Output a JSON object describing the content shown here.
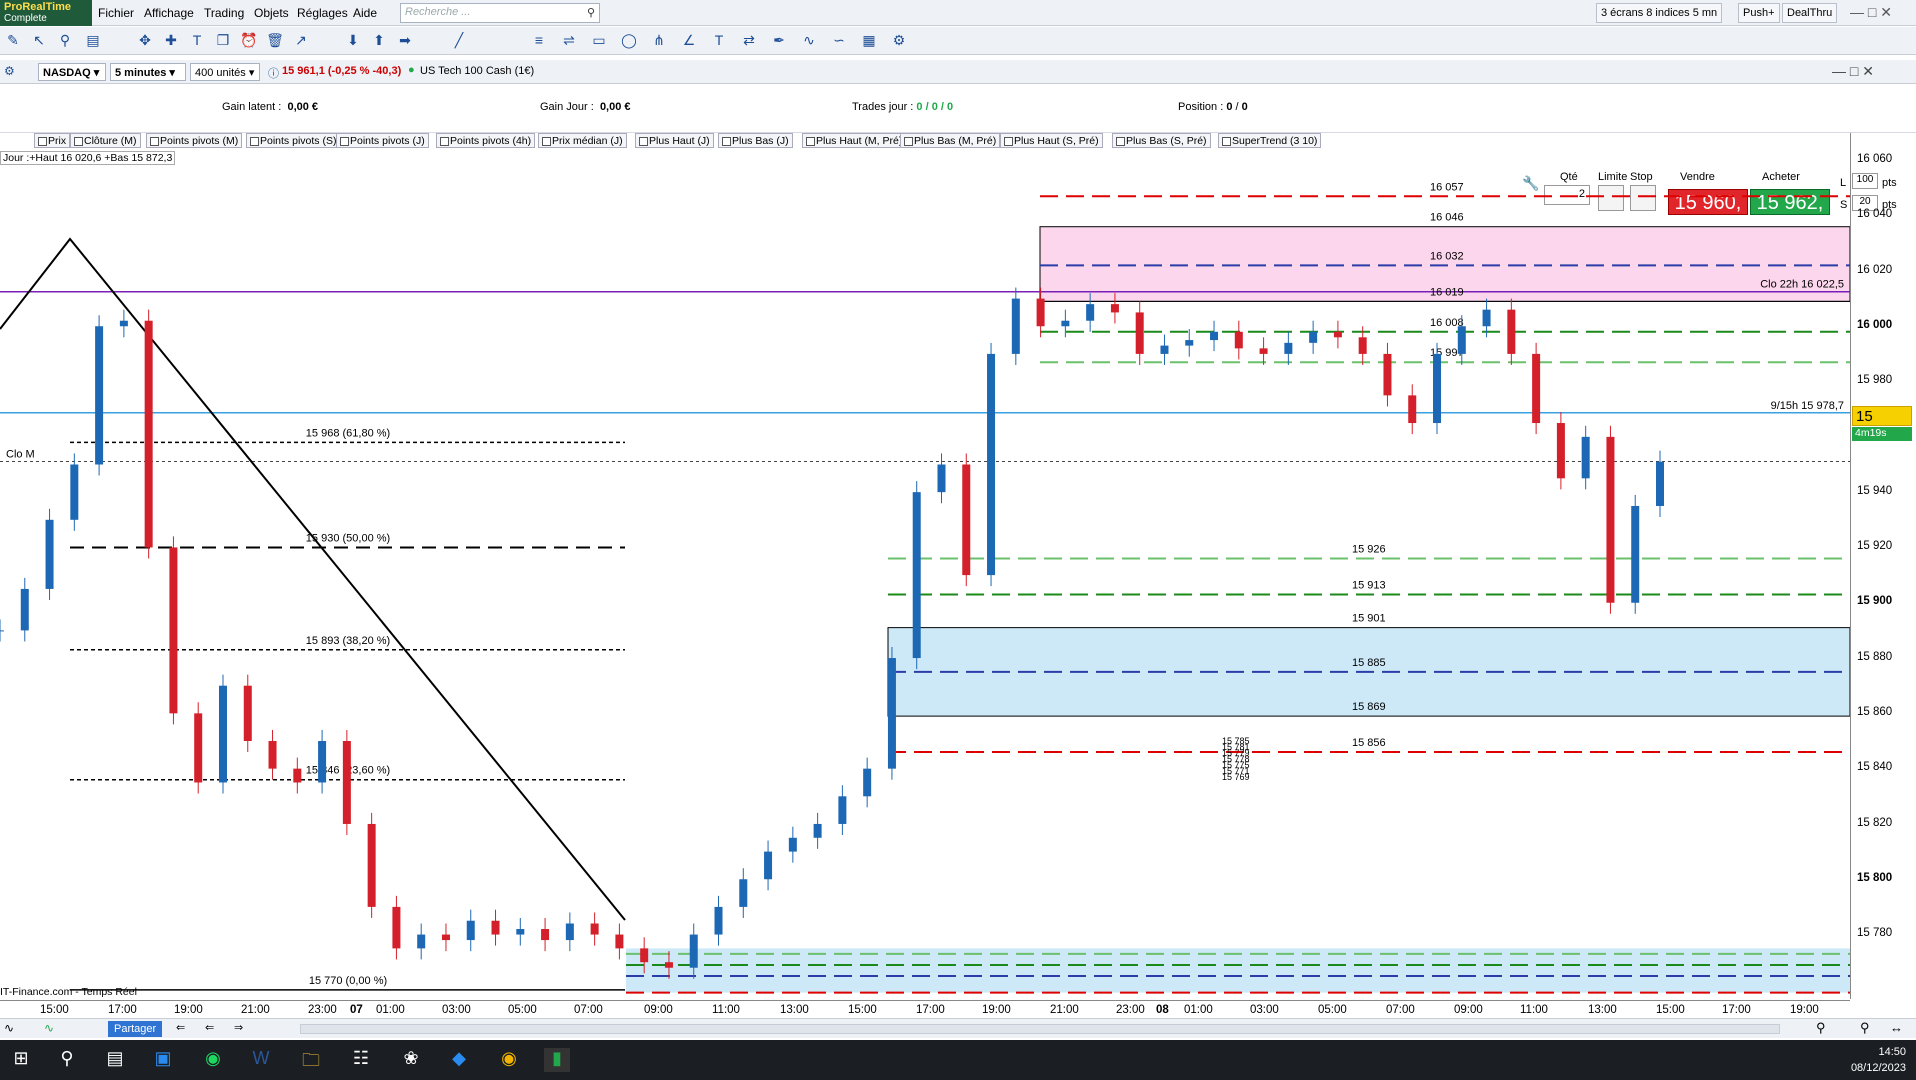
{
  "app": {
    "logo_line1": "ProRealTime",
    "logo_line2": "Complete"
  },
  "menu": [
    "Fichier",
    "Affichage",
    "Trading",
    "Objets",
    "Réglages",
    "Aide"
  ],
  "search": {
    "placeholder": "Recherche ..."
  },
  "topright": {
    "layout": "3 écrans 8 indices 5 mn",
    "push": "Push+",
    "dealthru": "DealThru"
  },
  "instrument": {
    "market": "NASDAQ",
    "timeframe": "5 minutes",
    "units": "400 unités",
    "quote": "15 961,1 (-0,25 % -40,3)",
    "name": "US Tech 100 Cash (1€)"
  },
  "info": {
    "gain_latent_label": "Gain latent :",
    "gain_latent": "0,00 €",
    "gain_jour_label": "Gain Jour :",
    "gain_jour": "0,00 €",
    "trades_label": "Trades jour :",
    "trades": "0 / 0 / 0",
    "position_label": "Position :",
    "position": "0",
    "position2": "0"
  },
  "order": {
    "qte_label": "Qté",
    "qte": "2",
    "limite_label": "Limite",
    "stop_label": "Stop",
    "vendre_label": "Vendre",
    "acheter_label": "Acheter",
    "sell": "15 960,",
    "buy": "15 962,",
    "l_label": "L",
    "l_val": "100",
    "s_label": "S",
    "s_val": "20",
    "pts": "pts"
  },
  "indicators": [
    "Prix",
    "Clôture (M)",
    "Points pivots (M)",
    "Points pivots (S)",
    "Points pivots (J)",
    "Points pivots (4h)",
    "Prix médian (J)",
    "Plus Haut (J)",
    "Plus Bas (J)",
    "Plus Haut (M, Pré)",
    "Plus Bas (M, Pré)",
    "Plus Haut (S, Pré)",
    "Plus Bas (S, Pré)",
    "SuperTrend (3 10)"
  ],
  "jour_label": "Jour :+Haut 16 020,6 +Bas 15 872,3",
  "source": "IT-Finance.com - Temps Réel",
  "y_ticks": [
    "16 060",
    "16 040",
    "16 020",
    "16 000",
    "15 980",
    "15 960",
    "15 940",
    "15 920",
    "15 900",
    "15 880",
    "15 860",
    "15 840",
    "15 820",
    "15 800",
    "15 780"
  ],
  "x_ticks": [
    "15:00",
    "17:00",
    "19:00",
    "21:00",
    "23:00",
    "07",
    "01:00",
    "03:00",
    "05:00",
    "07:00",
    "09:00",
    "11:00",
    "13:00",
    "15:00",
    "17:00",
    "19:00",
    "21:00",
    "23:00",
    "08",
    "01:00",
    "03:00",
    "05:00",
    "07:00",
    "09:00",
    "11:00",
    "13:00",
    "15:00",
    "17:00",
    "19:00"
  ],
  "fib_labels": [
    "15 968 (61,80 %)",
    "15 930 (50,00 %)",
    "15 893 (38,20 %)",
    "15 846 (23,60 %)",
    "15 770 (0,00 %)"
  ],
  "level_labels_top": [
    "16 057",
    "16 046",
    "16 032",
    "16 019",
    "16 008",
    "15 997"
  ],
  "level_labels_mid": [
    "15 926",
    "15 913",
    "15 901",
    "15 885",
    "15 869",
    "15 856"
  ],
  "level_labels_low": [
    "15 785",
    "15 781",
    "15 779",
    "15 778",
    "15 775",
    "15 771",
    "15 769"
  ],
  "annotations": {
    "clo22h": "Clo 22h 16 022,5",
    "nine15": "9/15h 15 978,7",
    "clom": "Clo M"
  },
  "price_badge": "15 961,1",
  "time_badge": "4m19s",
  "bottom": {
    "partager": "Partager"
  },
  "clock": {
    "time": "14:50",
    "date": "08/12/2023"
  },
  "chart_data": {
    "type": "line",
    "title": "",
    "ylim": [
      15760,
      16066
    ],
    "series": [
      {
        "values": [
          15900,
          15915,
          15940,
          15960,
          16010,
          16012,
          15930,
          15870,
          15845,
          15880,
          15860,
          15850,
          15845,
          15860,
          15830,
          15800,
          15785,
          15790,
          15788,
          15795,
          15790,
          15792,
          15788,
          15794,
          15790,
          15785,
          15780,
          15778,
          15790,
          15800,
          15810,
          15820,
          15825,
          15830,
          15840,
          15850,
          15890,
          15950,
          15960,
          15920,
          16000,
          16020,
          16010,
          16012,
          16018,
          16015,
          16000,
          16003,
          16005,
          16008,
          16002,
          16000,
          16004,
          16008,
          16006,
          16000,
          15985,
          15975,
          16000,
          16010,
          16016,
          16000,
          15975,
          15955,
          15970,
          15910,
          15945,
          15961
        ]
      }
    ]
  }
}
